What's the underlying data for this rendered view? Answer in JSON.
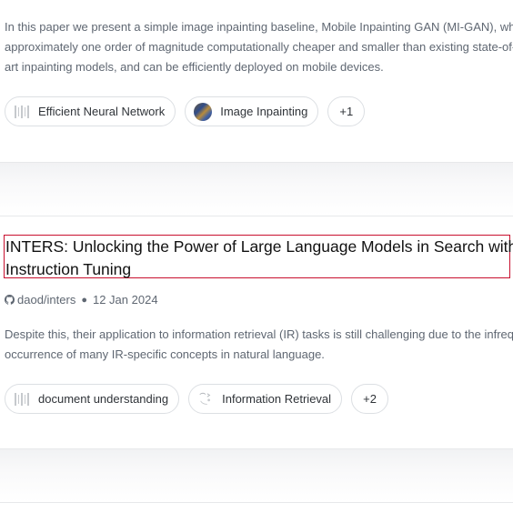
{
  "paper1": {
    "abstract_lines": [
      "In this paper we present a simple image inpainting baseline, Mobile Inpainting GAN (MI-GAN), which is",
      "approximately one order of magnitude computationally cheaper and smaller than existing state-of-the-",
      "art inpainting models, and can be efficiently deployed on mobile devices."
    ],
    "tags": [
      {
        "label": "Efficient Neural Network",
        "icon": "barcode-icon"
      },
      {
        "label": "Image Inpainting",
        "icon": "thumbnail-icon"
      }
    ],
    "more": "+1"
  },
  "paper2": {
    "title_lines": [
      "INTERS: Unlocking the Power of Large Language Models in Search with",
      "Instruction Tuning"
    ],
    "repo": "daod/inters",
    "date": "12 Jan 2024",
    "abstract_lines": [
      "Despite this, their application to information retrieval (IR) tasks is still challenging due to the infrequent",
      "occurrence of many IR-specific concepts in natural language."
    ],
    "tags": [
      {
        "label": "document understanding",
        "icon": "barcode-icon"
      },
      {
        "label": "Information Retrieval",
        "icon": "sketch-icon"
      }
    ],
    "more": "+2"
  },
  "colors": {
    "title_outline": "#c8102e",
    "body_text": "#5f6772",
    "tag_border": "#dcdfe3"
  }
}
